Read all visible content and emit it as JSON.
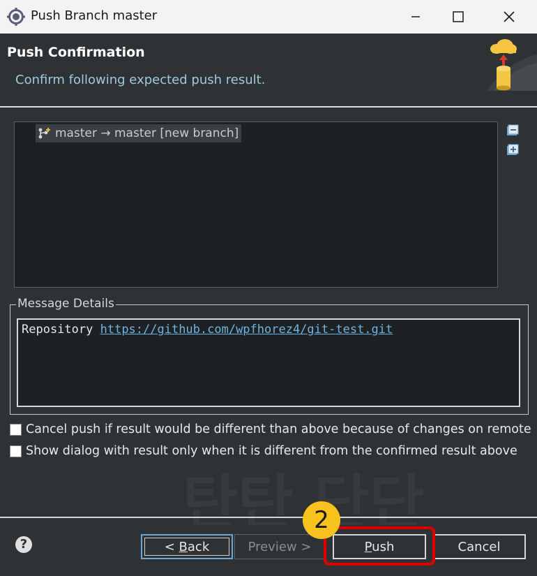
{
  "window": {
    "title": "Push Branch master"
  },
  "header": {
    "title": "Push Confirmation",
    "description": "Confirm following expected push result."
  },
  "tree": {
    "items": [
      {
        "label": "master → master [new branch]"
      }
    ]
  },
  "message_details": {
    "label": "Message Details",
    "repository_label": "Repository",
    "repository_url": "https://github.com/wpfhorez4/git-test.git"
  },
  "options": [
    {
      "label": "Cancel push if result would be different than above because of changes on remote",
      "checked": false
    },
    {
      "label": "Show dialog with result only when it is different from the confirmed result above",
      "checked": false
    }
  ],
  "footer": {
    "help": "?",
    "back_arrow": "< ",
    "back_mnemonic": "B",
    "back_rest": "ack",
    "preview_label": "Preview >",
    "push_mnemonic": "P",
    "push_rest": "ush",
    "cancel_label": "Cancel"
  },
  "annotation": {
    "step": "2"
  },
  "watermark": {
    "text": "탄탄 단단"
  },
  "colors": {
    "accent": "#6aa6d6",
    "highlight": "#e00000",
    "badge": "#f7c21e",
    "link": "#6fb3e0"
  }
}
